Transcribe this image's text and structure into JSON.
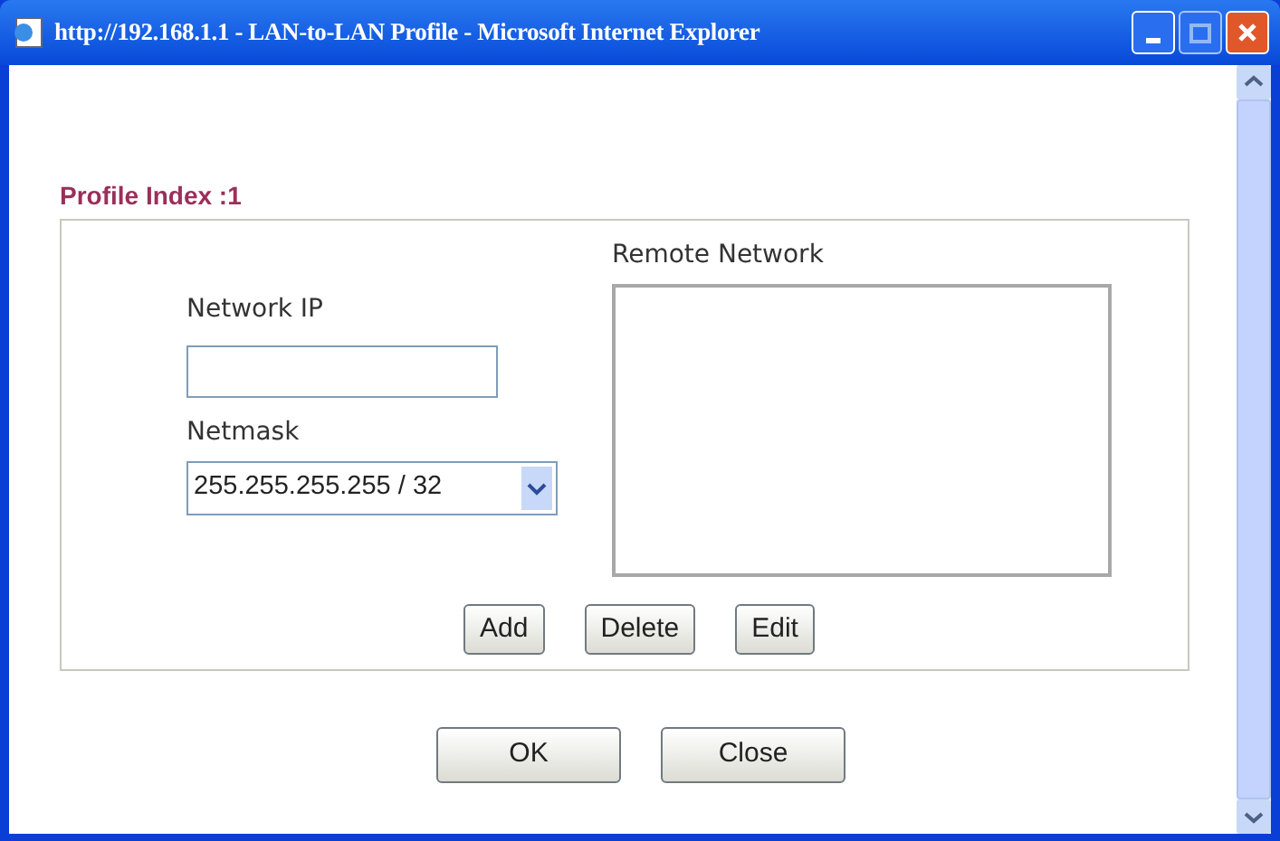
{
  "window": {
    "title": "http://192.168.1.1 - LAN-to-LAN Profile - Microsoft Internet Explorer"
  },
  "profile_index": "Profile Index :1",
  "network_ip": {
    "label": "Network IP"
  },
  "netmask": {
    "label": "Netmask",
    "value": "255.255.255.255 / 32"
  },
  "remote_network": {
    "label": "Remote Network"
  },
  "list_buttons": [
    "Add",
    "Delete",
    "Edit"
  ],
  "dialog_buttons": [
    "OK",
    "Close"
  ]
}
